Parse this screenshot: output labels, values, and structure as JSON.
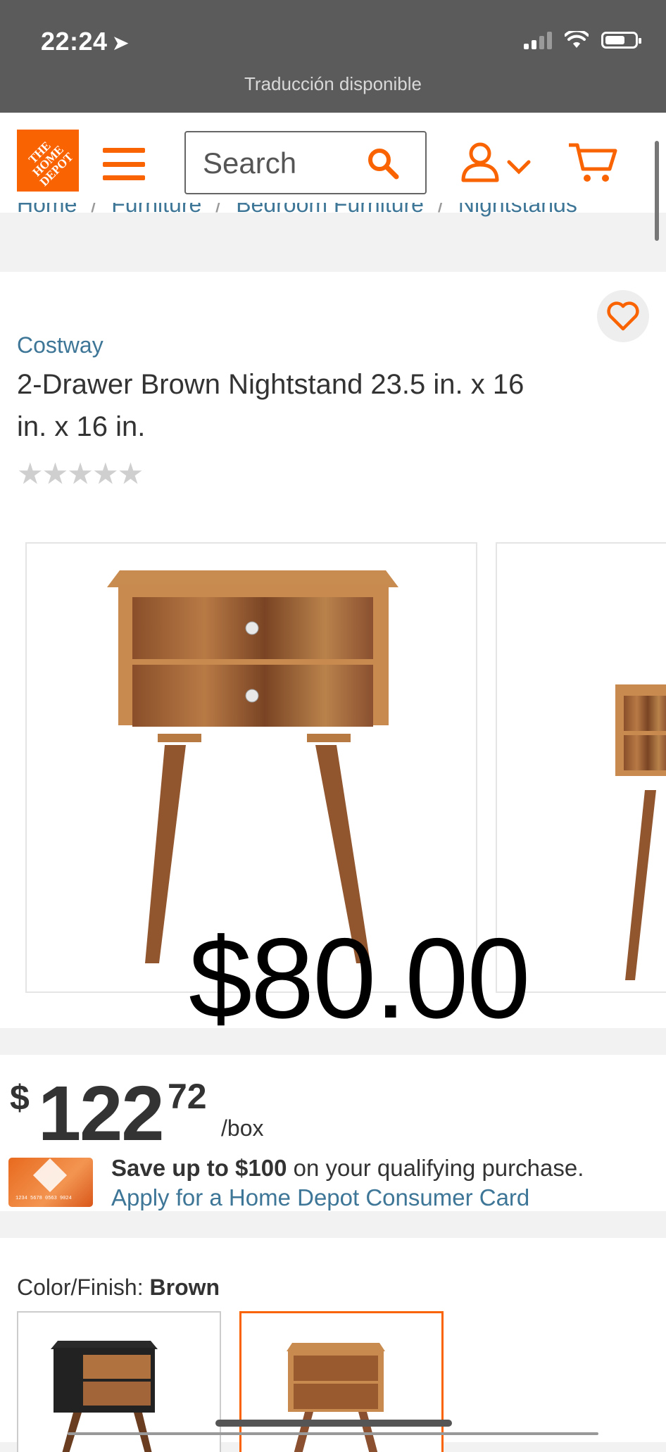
{
  "status_bar": {
    "time": "22:24",
    "translation_banner": "Traducción disponible"
  },
  "header": {
    "logo_text": "THE HOME DEPOT",
    "search_placeholder": "Search"
  },
  "breadcrumb": [
    "Home",
    "Furniture",
    "Bedroom Furniture",
    "Nightstands"
  ],
  "product": {
    "brand": "Costway",
    "title": "2-Drawer Brown Nightstand 23.5 in. x 16 in. x 16 in.",
    "rating_stars": "★★★★★",
    "overlay_price": "$80.00"
  },
  "pricing": {
    "currency": "$",
    "dollars": "122",
    "cents": "72",
    "unit": "/box",
    "card_number": "1234 5678 0563 9024",
    "save_bold": "Save up to $100",
    "save_rest": " on your qualifying purchase.",
    "apply_link": "Apply for a Home Depot Consumer Card"
  },
  "color": {
    "label": "Color/Finish: ",
    "value": "Brown"
  },
  "colors": {
    "brand_orange": "#f96302",
    "link_blue": "#3e7697"
  }
}
